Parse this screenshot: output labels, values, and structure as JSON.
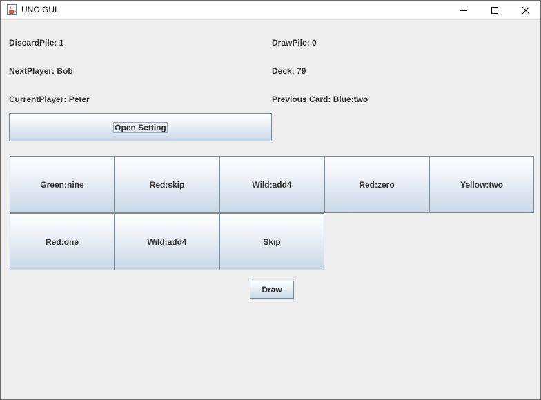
{
  "window": {
    "title": "UNO GUI"
  },
  "info": {
    "discard_pile": "DiscardPile: 1",
    "draw_pile": "DrawPile: 0",
    "next_player": "NextPlayer: Bob",
    "deck": "Deck: 79",
    "current_player": "CurrentPlayer: Peter",
    "previous_card": "Previous Card: Blue:two"
  },
  "buttons": {
    "open_setting": "Open Setting",
    "draw": "Draw"
  },
  "cards": [
    "Green:nine",
    "Red:skip",
    "Wild:add4",
    "Red:zero",
    "Yellow:two",
    "Red:one",
    "Wild:add4",
    "Skip"
  ],
  "icons": {
    "app": "java-coffee-cup-icon",
    "minimize": "minimize-icon",
    "maximize": "maximize-icon",
    "close": "close-icon"
  }
}
